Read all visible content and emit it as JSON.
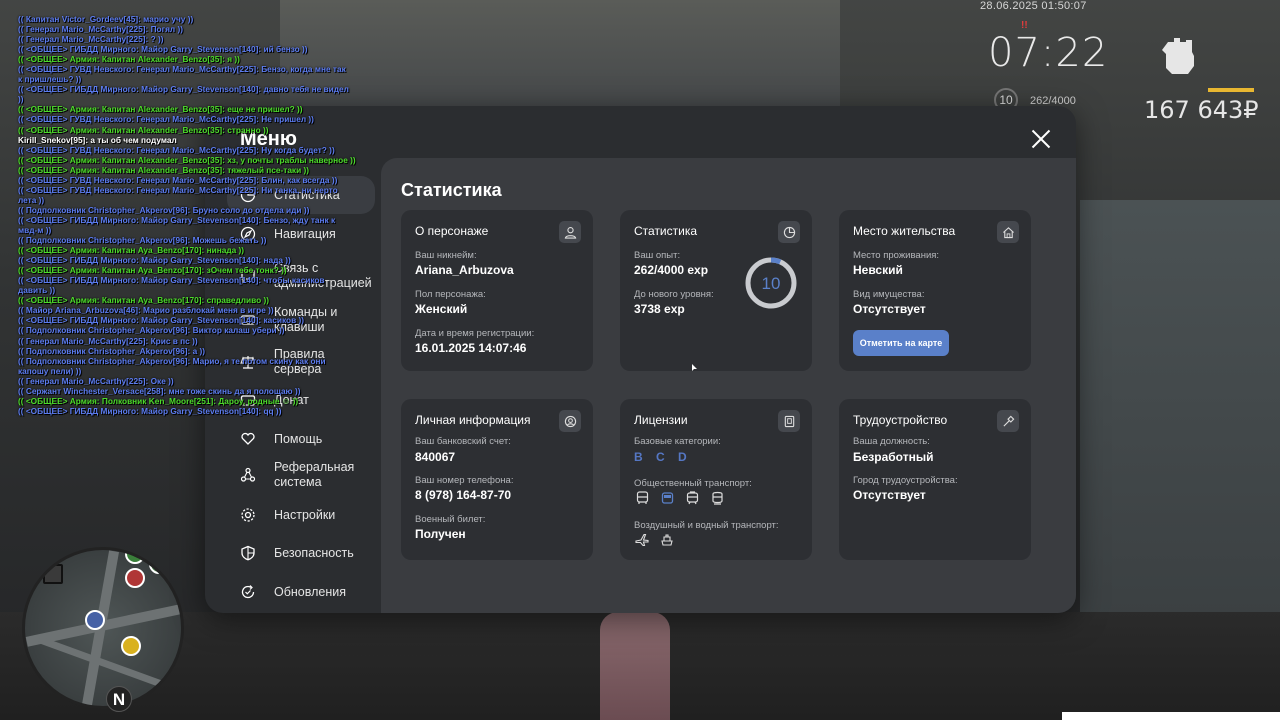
{
  "hud": {
    "datetime": "28.06.2025 01:50:07",
    "clock": "07:22",
    "clock_mark": "!!",
    "money": "167 643₽",
    "level": "10",
    "exp": "262/4000",
    "armor_color": "#e8b731"
  },
  "chat": [
    {
      "text": "(( Капитан Victor_Gordeev[45]: марио учу ))",
      "color": "blue"
    },
    {
      "text": "(( Генерал Mario_McCarthy[225]: Погял ))",
      "color": "blue"
    },
    {
      "text": "(( Генерал Mario_McCarthy[225]: ? ))",
      "color": "blue"
    },
    {
      "text": "(( <ОБЩЕЕ> ГИБДД Мирного: Майор Garry_Stevenson[140]: ий бензо ))",
      "color": "blue"
    },
    {
      "text": "(( <ОБЩЕЕ> Армия: Капитан Alexander_Benzo[35]: я ))",
      "color": "green"
    },
    {
      "text": "(( <ОБЩЕЕ> ГУВД Невского: Генерал Mario_McCarthy[225]: Бензо, когда мне так",
      "color": "blue"
    },
    {
      "text": "к пришлешь? ))",
      "color": "blue"
    },
    {
      "text": "(( <ОБЩЕЕ> ГИБДД Мирного: Майор Garry_Stevenson[140]: давно тебя не видел",
      "color": "blue"
    },
    {
      "text": "))",
      "color": "blue"
    },
    {
      "text": "(( <ОБЩЕЕ> Армия: Капитан Alexander_Benzo[35]: еще не пришел? ))",
      "color": "green"
    },
    {
      "text": "(( <ОБЩЕЕ> ГУВД Невского: Генерал Mario_McCarthy[225]: Не пришел ))",
      "color": "blue"
    },
    {
      "text": "(( <ОБЩЕЕ> Армия: Капитан Alexander_Benzo[35]: странно ))",
      "color": "green"
    },
    {
      "text": "Kirill_Snekov[95]: а ты об чем подумал",
      "color": "white"
    },
    {
      "text": "(( <ОБЩЕЕ> ГУВД Невского: Генерал Mario_McCarthy[225]: Ну когда будет? ))",
      "color": "blue"
    },
    {
      "text": "(( <ОБЩЕЕ> Армия: Капитан Alexander_Benzo[35]: хз, у почты траблы наверное ))",
      "color": "green"
    },
    {
      "text": "(( <ОБЩЕЕ> Армия: Капитан Alexander_Benzo[35]: тяжелый псе-таки ))",
      "color": "green"
    },
    {
      "text": "(( <ОБЩЕЕ> ГУВД Невского: Генерал Mario_McCarthy[225]: Блин, как всегда ))",
      "color": "blue"
    },
    {
      "text": "(( <ОБЩЕЕ> ГУВД Невского: Генерал Mario_McCarthy[225]: Ни танка, ни нерто",
      "color": "blue"
    },
    {
      "text": "лета ))",
      "color": "blue"
    },
    {
      "text": "(( Подполковник Christopher_Akperov[96]: Бруно соло до отдела иди ))",
      "color": "blue"
    },
    {
      "text": "(( <ОБЩЕЕ> ГИБДД Мирного: Майор Garry_Stevenson[140]: Бензо, жду танк к",
      "color": "blue"
    },
    {
      "text": "мвд-м ))",
      "color": "blue"
    },
    {
      "text": "(( Подполковник Christopher_Akperov[96]: Можешь бежать ))",
      "color": "blue"
    },
    {
      "text": "(( <ОБЩЕЕ> Армия: Капитан Aya_Benzo[170]: нинада ))",
      "color": "green"
    },
    {
      "text": "(( <ОБЩЕЕ> ГИБДД Мирного: Майор Garry_Stevenson[140]: нада ))",
      "color": "blue"
    },
    {
      "text": "(( <ОБЩЕЕ> Армия: Капитан Aya_Benzo[170]: зОчем тебе тонк? ))",
      "color": "green"
    },
    {
      "text": "(( <ОБЩЕЕ> ГИБДД Мирного: Майор Garry_Stevenson[140]: чтобы касиков",
      "color": "blue"
    },
    {
      "text": " давить ))",
      "color": "blue"
    },
    {
      "text": "(( <ОБЩЕЕ> Армия: Капитан Aya_Benzo[170]: справедливо ))",
      "color": "green"
    },
    {
      "text": "(( Майор Ariana_Arbuzova[46]: Марио разблокай меня в игре ))",
      "color": "blue"
    },
    {
      "text": "(( <ОБЩЕЕ> ГИБДД Мирного: Майор Garry_Stevenson[140]: касиков ))",
      "color": "blue"
    },
    {
      "text": "(( Подполковник Christopher_Akperov[96]: Виктор калаш убери ))",
      "color": "blue"
    },
    {
      "text": "(( Генерал Mario_McCarthy[225]: Крис в пс ))",
      "color": "blue"
    },
    {
      "text": "(( Подполковник Christopher_Akperov[96]: а ))",
      "color": "blue"
    },
    {
      "text": "(( Подполковник Christopher_Akperov[96]: Марио, я те потом скину как они",
      "color": "blue"
    },
    {
      "text": "капошу пели) ))",
      "color": "blue"
    },
    {
      "text": "(( Генерал Mario_McCarthy[225]: Оке ))",
      "color": "blue"
    },
    {
      "text": "(( Сержант Winchester_Versace[258]: мне тоже скинь да я полощаю ))",
      "color": "blue"
    },
    {
      "text": "(( <ОБЩЕЕ> Армия: Полковник Ken_Moore[251]: Дароу, родные ☺ ))",
      "color": "green"
    },
    {
      "text": "(( <ОБЩЕЕ> ГИБДД Мирного: Майор Garry_Stevenson[140]: qq ))",
      "color": "blue"
    }
  ],
  "menu": {
    "title": "Меню",
    "nav": [
      {
        "label": "Статистика",
        "icon": "chart-icon",
        "active": true
      },
      {
        "label": "Навигация",
        "icon": "compass-icon"
      },
      {
        "label": "Связь с администрацией",
        "icon": "message-icon"
      },
      {
        "label": "Команды и клавиши",
        "icon": "keyboard-icon"
      },
      {
        "label": "Правила сервера",
        "icon": "scales-icon"
      },
      {
        "label": "Донат",
        "icon": "wallet-icon"
      },
      {
        "label": "Помощь",
        "icon": "heart-hand-icon"
      },
      {
        "label": "Реферальная система",
        "icon": "network-icon"
      },
      {
        "label": "Настройки",
        "icon": "gear-icon"
      },
      {
        "label": "Безопасность",
        "icon": "shield-icon"
      },
      {
        "label": "Обновления",
        "icon": "refresh-icon"
      }
    ]
  },
  "stats": {
    "title": "Статистика",
    "character": {
      "header": "О персонаже",
      "nick_label": "Ваш никнейм:",
      "nick": "Ariana_Arbuzova",
      "gender_label": "Пол персонажа:",
      "gender": "Женский",
      "reg_label": "Дата и время регистрации:",
      "reg": "16.01.2025 14:07:46"
    },
    "statistics": {
      "header": "Статистика",
      "exp_label": "Ваш опыт:",
      "exp": "262/4000 exp",
      "next_label": "До нового уровня:",
      "next": "3738 exp",
      "level": "10",
      "progress": 0.0655,
      "ring_color": "#5a80c9"
    },
    "residence": {
      "header": "Место жительства",
      "place_label": "Место проживания:",
      "place": "Невский",
      "property_label": "Вид имущества:",
      "property": "Отсутствует",
      "map_button": "Отметить на карте"
    },
    "personal": {
      "header": "Личная информация",
      "bank_label": "Ваш банковский счет:",
      "bank": "840067",
      "phone_label": "Ваш номер телефона:",
      "phone": "8 (978) 164-87-70",
      "military_label": "Военный билет:",
      "military": "Получен"
    },
    "licenses": {
      "header": "Лицензии",
      "base_label": "Базовые категории:",
      "base": "B C D",
      "public_label": "Общественный транспорт:",
      "air_label": "Воздушный и водный транспорт:"
    },
    "employment": {
      "header": "Трудоустройство",
      "position_label": "Ваша должность:",
      "position": "Безработный",
      "city_label": "Город трудоустройства:",
      "city": "Отсутствует"
    }
  }
}
